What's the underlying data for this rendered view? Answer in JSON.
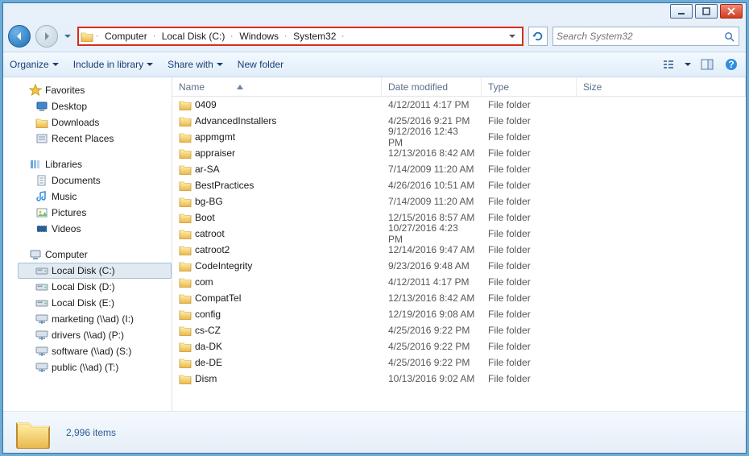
{
  "caption": {
    "min": "minimize",
    "max": "maximize",
    "close": "close"
  },
  "breadcrumbs": [
    "Computer",
    "Local Disk (C:)",
    "Windows",
    "System32"
  ],
  "search": {
    "placeholder": "Search System32"
  },
  "toolbar": {
    "organize": "Organize",
    "include": "Include in library",
    "share": "Share with",
    "newfolder": "New folder"
  },
  "columns": {
    "name": "Name",
    "date": "Date modified",
    "type": "Type",
    "size": "Size"
  },
  "tree": {
    "favorites": {
      "label": "Favorites",
      "items": [
        "Desktop",
        "Downloads",
        "Recent Places"
      ]
    },
    "libraries": {
      "label": "Libraries",
      "items": [
        "Documents",
        "Music",
        "Pictures",
        "Videos"
      ]
    },
    "computer": {
      "label": "Computer",
      "items": [
        "Local Disk (C:)",
        "Local Disk (D:)",
        "Local Disk (E:)",
        "marketing (\\\\ad) (I:)",
        "drivers (\\\\ad) (P:)",
        "software (\\\\ad) (S:)",
        "public (\\\\ad) (T:)"
      ]
    }
  },
  "files": [
    {
      "name": "0409",
      "date": "4/12/2011 4:17 PM",
      "type": "File folder"
    },
    {
      "name": "AdvancedInstallers",
      "date": "4/25/2016 9:21 PM",
      "type": "File folder"
    },
    {
      "name": "appmgmt",
      "date": "9/12/2016 12:43 PM",
      "type": "File folder"
    },
    {
      "name": "appraiser",
      "date": "12/13/2016 8:42 AM",
      "type": "File folder"
    },
    {
      "name": "ar-SA",
      "date": "7/14/2009 11:20 AM",
      "type": "File folder"
    },
    {
      "name": "BestPractices",
      "date": "4/26/2016 10:51 AM",
      "type": "File folder"
    },
    {
      "name": "bg-BG",
      "date": "7/14/2009 11:20 AM",
      "type": "File folder"
    },
    {
      "name": "Boot",
      "date": "12/15/2016 8:57 AM",
      "type": "File folder"
    },
    {
      "name": "catroot",
      "date": "10/27/2016 4:23 PM",
      "type": "File folder"
    },
    {
      "name": "catroot2",
      "date": "12/14/2016 9:47 AM",
      "type": "File folder"
    },
    {
      "name": "CodeIntegrity",
      "date": "9/23/2016 9:48 AM",
      "type": "File folder"
    },
    {
      "name": "com",
      "date": "4/12/2011 4:17 PM",
      "type": "File folder"
    },
    {
      "name": "CompatTel",
      "date": "12/13/2016 8:42 AM",
      "type": "File folder"
    },
    {
      "name": "config",
      "date": "12/19/2016 9:08 AM",
      "type": "File folder"
    },
    {
      "name": "cs-CZ",
      "date": "4/25/2016 9:22 PM",
      "type": "File folder"
    },
    {
      "name": "da-DK",
      "date": "4/25/2016 9:22 PM",
      "type": "File folder"
    },
    {
      "name": "de-DE",
      "date": "4/25/2016 9:22 PM",
      "type": "File folder"
    },
    {
      "name": "Dism",
      "date": "10/13/2016 9:02 AM",
      "type": "File folder"
    }
  ],
  "status": {
    "count": "2,996 items"
  }
}
